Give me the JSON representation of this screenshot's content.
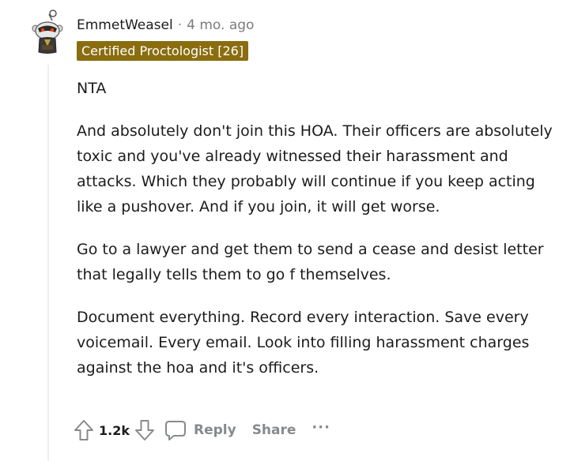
{
  "comment": {
    "author": "EmmetWeasel",
    "separator": "·",
    "timestamp": "4 mo. ago",
    "flair": "Certified Proctologist [26]",
    "paragraphs": [
      "NTA",
      "And absolutely don't join this HOA. Their officers are absolutely toxic and you've already witnessed their harassment and attacks. Which they probably will continue if you keep acting like a pushover. And if you join, it will get worse.",
      "Go to a lawyer and get them to send a cease and desist letter that legally tells them to go f themselves.",
      "Document everything. Record every interaction. Save every voicemail. Every email. Look into filling harassment charges against the hoa and it's officers."
    ]
  },
  "actions": {
    "score": "1.2k",
    "reply_label": "Reply",
    "share_label": "Share",
    "more_label": "···",
    "upvote_icon": "upvote-arrow-icon",
    "downvote_icon": "downvote-arrow-icon",
    "reply_icon": "speech-bubble-icon"
  },
  "colors": {
    "flair_bg": "#8a6d0f",
    "muted": "#878a8c",
    "text": "#1c1c1c"
  }
}
